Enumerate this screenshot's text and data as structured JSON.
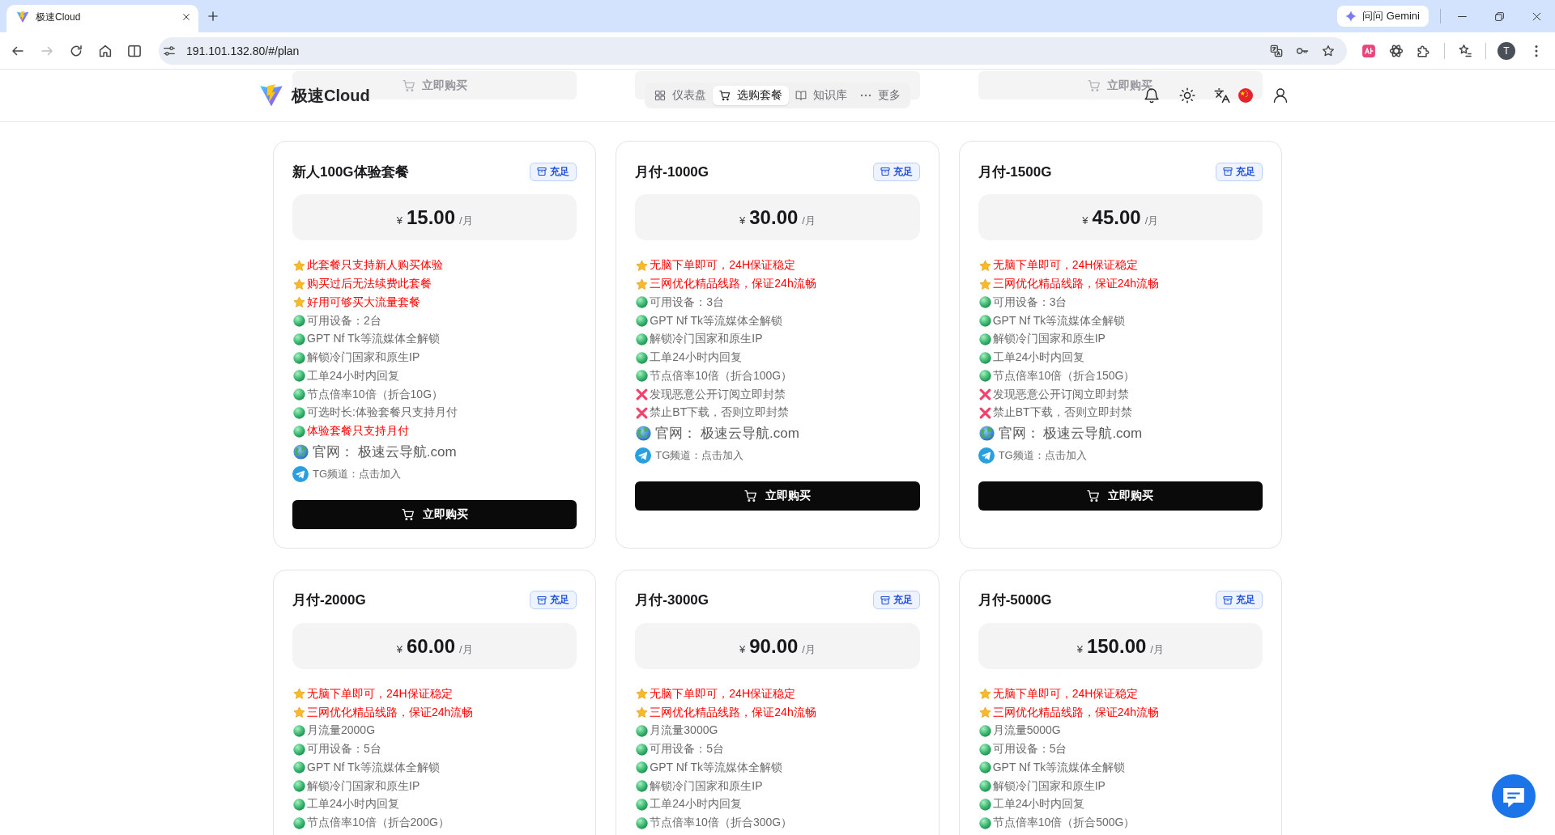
{
  "browser": {
    "tabs": [
      {
        "title": "极速Cloud",
        "selected": true
      }
    ],
    "assistant_button": "问问 Gemini",
    "history_buttons": [
      {
        "disabled": false
      },
      {
        "disabled": true
      }
    ],
    "url": "191.101.132.80/#/plan",
    "profile_initial": "T"
  },
  "header": {
    "underlay": [
      {
        "kind": "labelled",
        "label": "立即购买"
      },
      {
        "kind": "blank"
      },
      {
        "kind": "labelled",
        "label": "立即购买"
      }
    ],
    "brand": "极速Cloud",
    "nav": [
      {
        "label": "仪表盘",
        "selected": false
      },
      {
        "label": "选购套餐",
        "selected": true
      },
      {
        "label": "知识库",
        "selected": false
      },
      {
        "label": "更多",
        "selected": false
      }
    ]
  },
  "cards": [
    {
      "title": "新人100G体验套餐",
      "badge": "充足",
      "currency": "¥",
      "price": "15.00",
      "unit": "/月",
      "features": [
        {
          "kind": "star",
          "text": "此套餐只支持新人购买体验",
          "highlight": true
        },
        {
          "kind": "star",
          "text": "购买过后无法续费此套餐",
          "highlight": true
        },
        {
          "kind": "star",
          "text": "好用可够买大流量套餐",
          "highlight": true
        },
        {
          "kind": "dot",
          "text": "可用设备：2台",
          "highlight": false
        },
        {
          "kind": "dot",
          "text": "GPT Nf Tk等流媒体全解锁",
          "highlight": false
        },
        {
          "kind": "dot",
          "text": "解锁冷门国家和原生IP",
          "highlight": false
        },
        {
          "kind": "dot",
          "text": "工单24小时内回复",
          "highlight": false
        },
        {
          "kind": "dot",
          "text": "节点倍率10倍（折合10G）",
          "highlight": false
        },
        {
          "kind": "dot",
          "text": "可选时长:体验套餐只支持月付",
          "highlight": false
        },
        {
          "kind": "dot",
          "text": "体验套餐只支持月付",
          "highlight": true
        }
      ],
      "site": "官网： 极速云导航.com",
      "channel": "TG频道：点击加入",
      "button": "立即购买"
    },
    {
      "title": "月付-1000G",
      "badge": "充足",
      "currency": "¥",
      "price": "30.00",
      "unit": "/月",
      "features": [
        {
          "kind": "star",
          "text": "无脑下单即可，24H保证稳定",
          "highlight": true
        },
        {
          "kind": "star",
          "text": "三网优化精品线路，保证24h流畅",
          "highlight": true
        },
        {
          "kind": "dot",
          "text": "可用设备：3台",
          "highlight": false
        },
        {
          "kind": "dot",
          "text": "GPT Nf Tk等流媒体全解锁",
          "highlight": false
        },
        {
          "kind": "dot",
          "text": "解锁冷门国家和原生IP",
          "highlight": false
        },
        {
          "kind": "dot",
          "text": "工单24小时内回复",
          "highlight": false
        },
        {
          "kind": "dot",
          "text": "节点倍率10倍（折合100G）",
          "highlight": false
        },
        {
          "kind": "cross",
          "text": "发现恶意公开订阅立即封禁",
          "highlight": false
        },
        {
          "kind": "cross",
          "text": "禁止BT下载，否则立即封禁",
          "highlight": false
        }
      ],
      "site": "官网： 极速云导航.com",
      "channel": "TG频道：点击加入",
      "button": "立即购买"
    },
    {
      "title": "月付-1500G",
      "badge": "充足",
      "currency": "¥",
      "price": "45.00",
      "unit": "/月",
      "features": [
        {
          "kind": "star",
          "text": "无脑下单即可，24H保证稳定",
          "highlight": true
        },
        {
          "kind": "star",
          "text": "三网优化精品线路，保证24h流畅",
          "highlight": true
        },
        {
          "kind": "dot",
          "text": "可用设备：3台",
          "highlight": false
        },
        {
          "kind": "dot",
          "text": "GPT Nf Tk等流媒体全解锁",
          "highlight": false
        },
        {
          "kind": "dot",
          "text": "解锁冷门国家和原生IP",
          "highlight": false
        },
        {
          "kind": "dot",
          "text": "工单24小时内回复",
          "highlight": false
        },
        {
          "kind": "dot",
          "text": "节点倍率10倍（折合150G）",
          "highlight": false
        },
        {
          "kind": "cross",
          "text": "发现恶意公开订阅立即封禁",
          "highlight": false
        },
        {
          "kind": "cross",
          "text": "禁止BT下载，否则立即封禁",
          "highlight": false
        }
      ],
      "site": "官网： 极速云导航.com",
      "channel": "TG频道：点击加入",
      "button": "立即购买"
    },
    {
      "title": "月付-2000G",
      "badge": "充足",
      "currency": "¥",
      "price": "60.00",
      "unit": "/月",
      "features": [
        {
          "kind": "star",
          "text": "无脑下单即可，24H保证稳定",
          "highlight": true
        },
        {
          "kind": "star",
          "text": "三网优化精品线路，保证24h流畅",
          "highlight": true
        },
        {
          "kind": "dot",
          "text": "月流量2000G",
          "highlight": false
        },
        {
          "kind": "dot",
          "text": "可用设备：5台",
          "highlight": false
        },
        {
          "kind": "dot",
          "text": "GPT Nf Tk等流媒体全解锁",
          "highlight": false
        },
        {
          "kind": "dot",
          "text": "解锁冷门国家和原生IP",
          "highlight": false
        },
        {
          "kind": "dot",
          "text": "工单24小时内回复",
          "highlight": false
        },
        {
          "kind": "dot",
          "text": "节点倍率10倍（折合200G）",
          "highlight": false
        }
      ]
    },
    {
      "title": "月付-3000G",
      "badge": "充足",
      "currency": "¥",
      "price": "90.00",
      "unit": "/月",
      "features": [
        {
          "kind": "star",
          "text": "无脑下单即可，24H保证稳定",
          "highlight": true
        },
        {
          "kind": "star",
          "text": "三网优化精品线路，保证24h流畅",
          "highlight": true
        },
        {
          "kind": "dot",
          "text": "月流量3000G",
          "highlight": false
        },
        {
          "kind": "dot",
          "text": "可用设备：5台",
          "highlight": false
        },
        {
          "kind": "dot",
          "text": "GPT Nf Tk等流媒体全解锁",
          "highlight": false
        },
        {
          "kind": "dot",
          "text": "解锁冷门国家和原生IP",
          "highlight": false
        },
        {
          "kind": "dot",
          "text": "工单24小时内回复",
          "highlight": false
        },
        {
          "kind": "dot",
          "text": "节点倍率10倍（折合300G）",
          "highlight": false
        }
      ]
    },
    {
      "title": "月付-5000G",
      "badge": "充足",
      "currency": "¥",
      "price": "150.00",
      "unit": "/月",
      "features": [
        {
          "kind": "star",
          "text": "无脑下单即可，24H保证稳定",
          "highlight": true
        },
        {
          "kind": "star",
          "text": "三网优化精品线路，保证24h流畅",
          "highlight": true
        },
        {
          "kind": "dot",
          "text": "月流量5000G",
          "highlight": false
        },
        {
          "kind": "dot",
          "text": "可用设备：5台",
          "highlight": false
        },
        {
          "kind": "dot",
          "text": "GPT Nf Tk等流媒体全解锁",
          "highlight": false
        },
        {
          "kind": "dot",
          "text": "解锁冷门国家和原生IP",
          "highlight": false
        },
        {
          "kind": "dot",
          "text": "工单24小时内回复",
          "highlight": false
        },
        {
          "kind": "dot",
          "text": "节点倍率10倍（折合500G）",
          "highlight": false
        }
      ]
    }
  ]
}
